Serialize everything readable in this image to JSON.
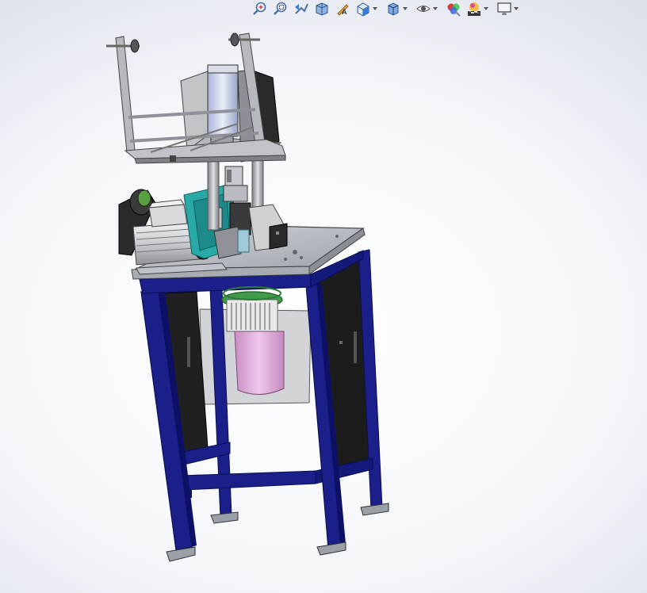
{
  "app": {
    "name": "3D CAD viewport"
  },
  "heads_up_toolbar": {
    "buttons": [
      {
        "id": "zoom-to-fit",
        "icon": "zoom-to-fit-icon",
        "dropdown": false
      },
      {
        "id": "zoom-to-area",
        "icon": "zoom-to-area-icon",
        "dropdown": false
      },
      {
        "id": "previous-view",
        "icon": "previous-view-icon",
        "dropdown": false
      },
      {
        "id": "section-view",
        "icon": "section-view-icon",
        "dropdown": false
      },
      {
        "id": "dynamic-annotation",
        "icon": "dynamic-annotation-icon",
        "dropdown": false
      },
      {
        "id": "view-orientation",
        "icon": "view-orientation-icon",
        "dropdown": true
      },
      {
        "id": "display-style",
        "icon": "display-style-icon",
        "dropdown": true
      },
      {
        "id": "hide-show-items",
        "icon": "hide-show-icon",
        "dropdown": true
      },
      {
        "id": "edit-appearance",
        "icon": "edit-appearance-icon",
        "dropdown": false
      },
      {
        "id": "apply-scene",
        "icon": "apply-scene-icon",
        "dropdown": true
      },
      {
        "id": "view-settings",
        "icon": "monitor-icon",
        "dropdown": true
      }
    ]
  },
  "model": {
    "colors": {
      "frame": "#1a1f8a",
      "frame_dark": "#0d1166",
      "panel": "#1e1e1e",
      "table_top": "#b9bcc4",
      "steel": "#9ea2a8",
      "teal": "#2aa9a9",
      "motor": "#d8dadd",
      "motor_dark": "#2a2a2a",
      "cylinder": "#e6b8e0",
      "cylinder_top": "#3f9a4a",
      "housing": "#c2c4c8",
      "bracket": "#cfd1d4"
    }
  }
}
